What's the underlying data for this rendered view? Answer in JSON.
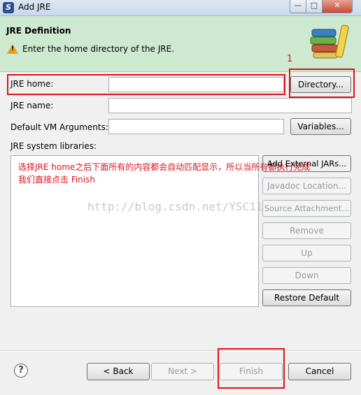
{
  "window": {
    "title": "Add JRE",
    "app_icon_glyph": "S",
    "controls": {
      "minimize": "—",
      "maximize": "□",
      "close": "✕"
    }
  },
  "header": {
    "title": "JRE Definition",
    "message": "Enter the home directory of the JRE.",
    "icon": "warning-icon",
    "banner_icon": "books-icon",
    "warn_glyph": "!"
  },
  "form": {
    "jre_home": {
      "label": "JRE home:",
      "value": ""
    },
    "jre_name": {
      "label": "JRE name:",
      "value": ""
    },
    "vm_args": {
      "label": "Default VM Arguments:",
      "value": ""
    },
    "libraries_label": "JRE system libraries:",
    "directory_button": "Directory...",
    "variables_button": "Variables..."
  },
  "library_buttons": {
    "add_external_jars": "Add External JARs...",
    "javadoc_location": "Javadoc Location...",
    "source_attachment": "Source Attachment...",
    "remove": "Remove",
    "up": "Up",
    "down": "Down",
    "restore_default": "Restore Default"
  },
  "annotation": {
    "number": "1",
    "text_line1": "选择JRE  home之后下面所有的内容都会自动匹配显示，所以当所有都执行完成",
    "text_line2": "我们直接点击 Finish"
  },
  "watermark": "http://blog.csdn.net/YSC1123",
  "footer": {
    "help_glyph": "?",
    "back": "< Back",
    "next": "Next >",
    "finish": "Finish",
    "cancel": "Cancel"
  },
  "colors": {
    "header_bg": "#cde9cf",
    "annotation_red": "#d9141c",
    "disabled_text": "#9a9a9a"
  }
}
